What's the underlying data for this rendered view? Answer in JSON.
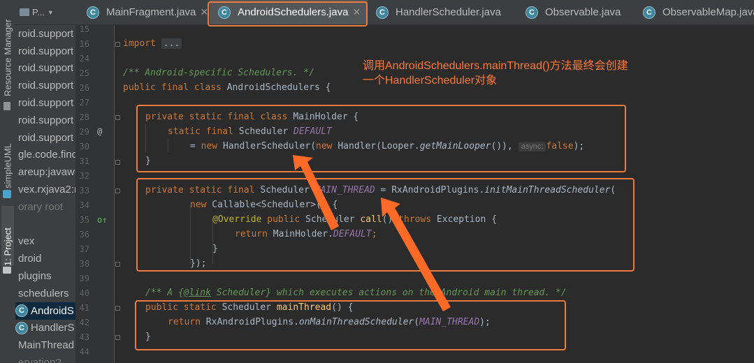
{
  "side_strip": {
    "tabs": [
      "Resource Manager",
      "simpleUML",
      "1: Project"
    ]
  },
  "project_panel": {
    "header_label": "P...",
    "rows": [
      {
        "text": "roid.support",
        "style": "normal"
      },
      {
        "text": "roid.support",
        "style": "normal"
      },
      {
        "text": "roid.support",
        "style": "normal"
      },
      {
        "text": "roid.support",
        "style": "normal"
      },
      {
        "text": "roid.support",
        "style": "normal"
      },
      {
        "text": "roid.support",
        "style": "normal"
      },
      {
        "text": "roid.support",
        "style": "normal"
      },
      {
        "text": "gle.code.find",
        "style": "normal"
      },
      {
        "text": "areup:javawr",
        "style": "normal"
      },
      {
        "text": "vex.rxjava2:rx",
        "style": "normal"
      },
      {
        "text": "orary root",
        "style": "dim"
      },
      {
        "text": "",
        "style": "normal"
      },
      {
        "text": "vex",
        "style": "normal"
      },
      {
        "text": "droid",
        "style": "normal"
      },
      {
        "text": "plugins",
        "style": "normal"
      },
      {
        "text": "schedulers",
        "style": "normal"
      },
      {
        "text": "AndroidS",
        "style": "sel",
        "icon": "C"
      },
      {
        "text": "HandlerS",
        "style": "normal",
        "icon": "C"
      },
      {
        "text": "MainThread",
        "style": "normal"
      },
      {
        "text": "ervation?",
        "style": "dim"
      }
    ]
  },
  "editor_tabs": [
    {
      "label": "MainFragment.java",
      "active": false
    },
    {
      "label": "AndroidSchedulers.java",
      "active": true
    },
    {
      "label": "HandlerScheduler.java",
      "active": false
    },
    {
      "label": "Observable.java",
      "active": false
    },
    {
      "label": "ObservableMap.java",
      "active": false
    }
  ],
  "line_numbers": [
    "15",
    "16",
    "24",
    "25",
    "26",
    "27",
    "28",
    "29",
    "30",
    "31",
    "32",
    "33",
    "34",
    "35",
    "36",
    "37",
    "38",
    "39",
    "40",
    "41",
    "42",
    "43",
    "44"
  ],
  "gutter_marks": {
    "line_29": "@",
    "line_35": "o↑"
  },
  "code": {
    "l16_import": "import",
    "l16_fold": "...",
    "l25": "/** Android-specific Schedulers. */",
    "l26_kw": "public final class",
    "l26_name": " AndroidSchedulers {",
    "l28_kw": "private static final class",
    "l28_name": " MainHolder {",
    "l29_kw": "static final",
    "l29_type": " Scheduler ",
    "l29_field": "DEFAULT",
    "l30_a": "= ",
    "l30_new1": "new",
    "l30_b": " HandlerScheduler(",
    "l30_new2": "new",
    "l30_c": " Handler(Looper.",
    "l30_m": "getMainLooper",
    "l30_d": "()), ",
    "l30_hint": "async:",
    "l30_false": "false",
    "l30_e": ");",
    "l31": "}",
    "l33_kw": "private static final",
    "l33_a": " Scheduler ",
    "l33_field": "MAIN_THREAD",
    "l33_b": " = RxAndroidPlugins.",
    "l33_m": "initMainThreadScheduler",
    "l33_c": "(",
    "l34_new": "new",
    "l34_a": " Callable<Scheduler>() {",
    "l35_ann": "@Override",
    "l35_kw": " public",
    "l35_a": " Scheduler ",
    "l35_m": "call",
    "l35_b": "() ",
    "l35_throws": "throws",
    "l35_c": " Exception {",
    "l36_return": "return",
    "l36_a": " MainHolder.",
    "l36_field": "DEFAULT",
    "l36_b": ";",
    "l37": "}",
    "l38": "});",
    "l40_a": "/** A {",
    "l40_link": "@link",
    "l40_b": " Scheduler",
    "l40_c": "} which executes actions on the Android main thread. */",
    "l41_kw": "public static",
    "l41_a": " Scheduler ",
    "l41_m": "mainThread",
    "l41_b": "() {",
    "l42_return": "return",
    "l42_a": " RxAndroidPlugins.",
    "l42_m": "onMainThreadScheduler",
    "l42_b": "(",
    "l42_field": "MAIN_THREAD",
    "l42_c": ");",
    "l43": "}"
  },
  "annotation_text": {
    "line1": "调用AndroidSchedulers.mainThread()方法最终会创建",
    "line2": "一个HandlerScheduler对象"
  },
  "colors": {
    "annotation": "#ff7733",
    "highlight_box": "#ee7b3b",
    "keyword": "#cc7832",
    "comment": "#629755",
    "field": "#9876aa",
    "method": "#ffc66d"
  }
}
